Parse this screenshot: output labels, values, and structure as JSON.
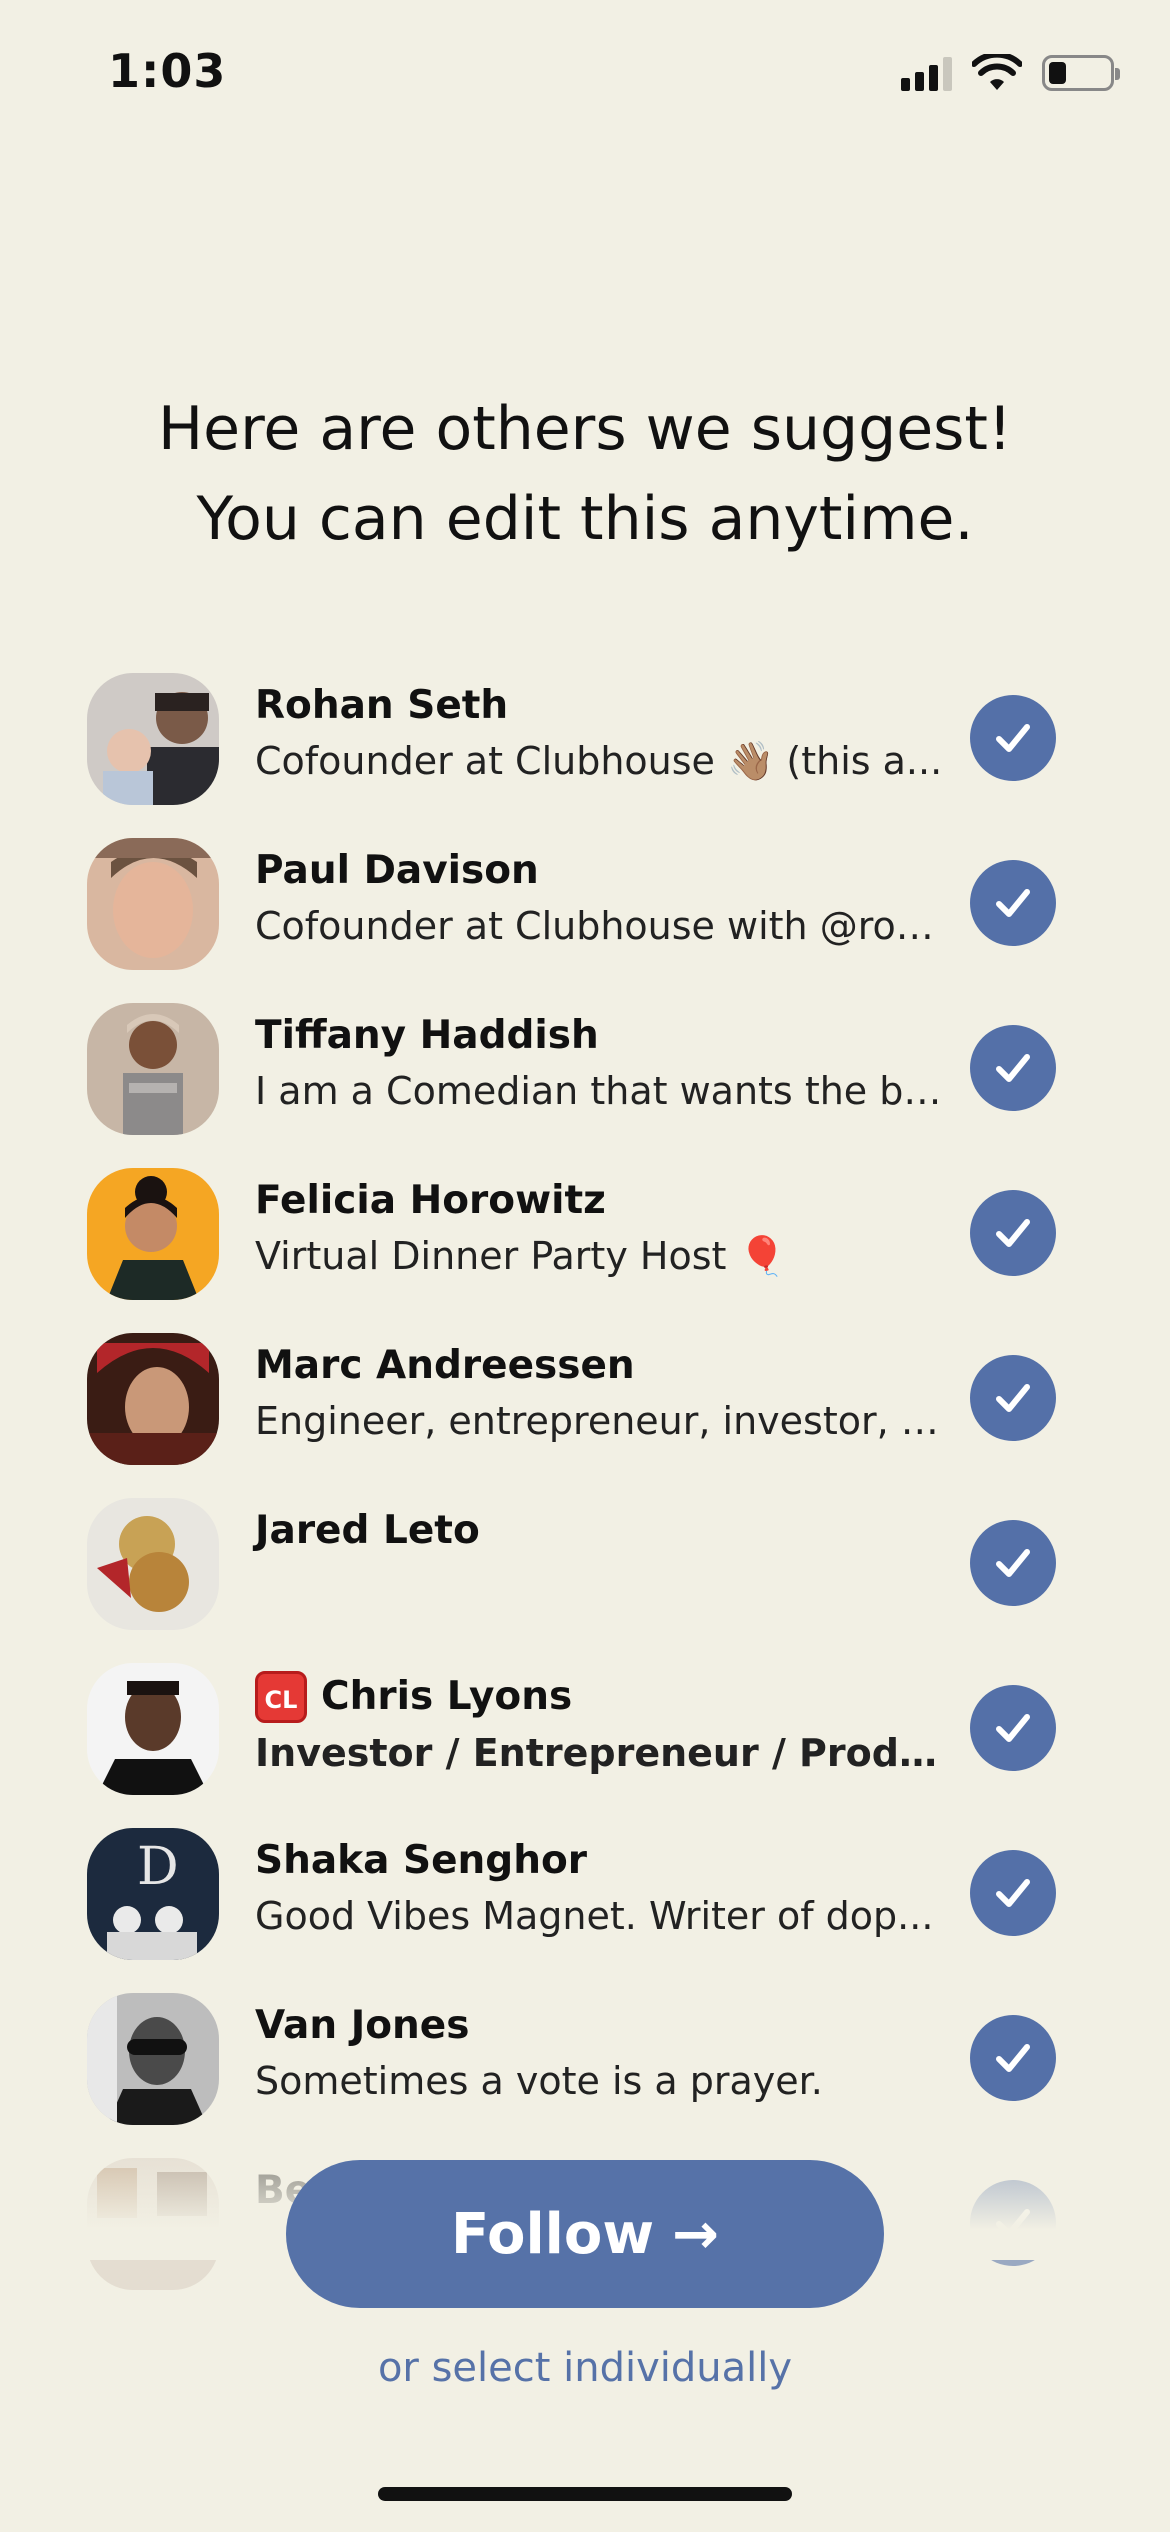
{
  "status_bar": {
    "time": "1:03",
    "battery_level_fraction": 0.3
  },
  "heading": {
    "line1": "Here are others we suggest!",
    "line2": "You can edit this anytime."
  },
  "users": [
    {
      "name": "Rohan Seth",
      "bio": "Cofounder at Clubhouse 👋🏽 (this a...",
      "selected": true
    },
    {
      "name": "Paul Davison",
      "bio": "Cofounder at Clubhouse with @roh...",
      "selected": true
    },
    {
      "name": "Tiffany Haddish",
      "bio": "I am a Comedian that wants the be...",
      "selected": true
    },
    {
      "name": "Felicia Horowitz",
      "bio": "Virtual Dinner Party Host 🎈",
      "selected": true
    },
    {
      "name": "Marc Andreessen",
      "bio": "Engineer, entrepreneur, investor, st...",
      "selected": true
    },
    {
      "name": "Jared Leto",
      "bio": "",
      "selected": true
    },
    {
      "name": "Chris Lyons",
      "badge": "CL",
      "bio": "Investor / Entrepreneur / Producer /...",
      "selected": true
    },
    {
      "name": "Shaka Senghor",
      "bio": "Good Vibes Magnet. Writer of dop...",
      "selected": true
    },
    {
      "name": "Van Jones",
      "bio": "Sometimes a vote is a prayer.",
      "selected": true
    },
    {
      "name": "Be",
      "bio": "",
      "selected": true
    }
  ],
  "actions": {
    "follow_label": "Follow",
    "follow_arrow": "→",
    "select_individually": "or select individually"
  },
  "colors": {
    "background": "#F2F0E4",
    "accent": "#5672A8"
  }
}
